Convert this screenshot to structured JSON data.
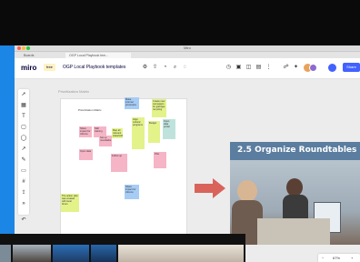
{
  "window": {
    "title": "Miro"
  },
  "tabs": [
    {
      "label": "Boards"
    },
    {
      "label": "OGP Local Playbook tem..."
    }
  ],
  "toolbar": {
    "logo": "miro",
    "plan_badge": "free",
    "board_name": "OGP Local Playbook templates",
    "share_label": "Share"
  },
  "canvas": {
    "frame_label": "Prioritization Matrix",
    "matrix_title": "Prioritization Matrix",
    "notes": [
      {
        "text": "Share impact for citizens"
      },
      {
        "text": "Skill training"
      },
      {
        "text": "Map all relevant stakeholders"
      },
      {
        "text": "Make internal processes"
      },
      {
        "text": "Align cultural programs"
      },
      {
        "text": "Create new campaigns for garbage recycling"
      },
      {
        "text": "Open data portal"
      },
      {
        "text": "Budget"
      },
      {
        "text": "Set up roundtable"
      },
      {
        "text": "Open data"
      },
      {
        "text": "Follow up"
      },
      {
        "text": "Pilot"
      },
      {
        "text": "Share impact for citizens"
      },
      {
        "text": "The action plan was created with local forum"
      }
    ],
    "slide": {
      "title": "2.5 Organize Roundtables"
    }
  },
  "zoom": {
    "value": "67%",
    "minus": "−",
    "plus": "+"
  },
  "colors": {
    "accent": "#4262ff",
    "desktop": "#1c86e6",
    "arrow": "#d9635a",
    "slide_header": "#5b7d9f"
  }
}
